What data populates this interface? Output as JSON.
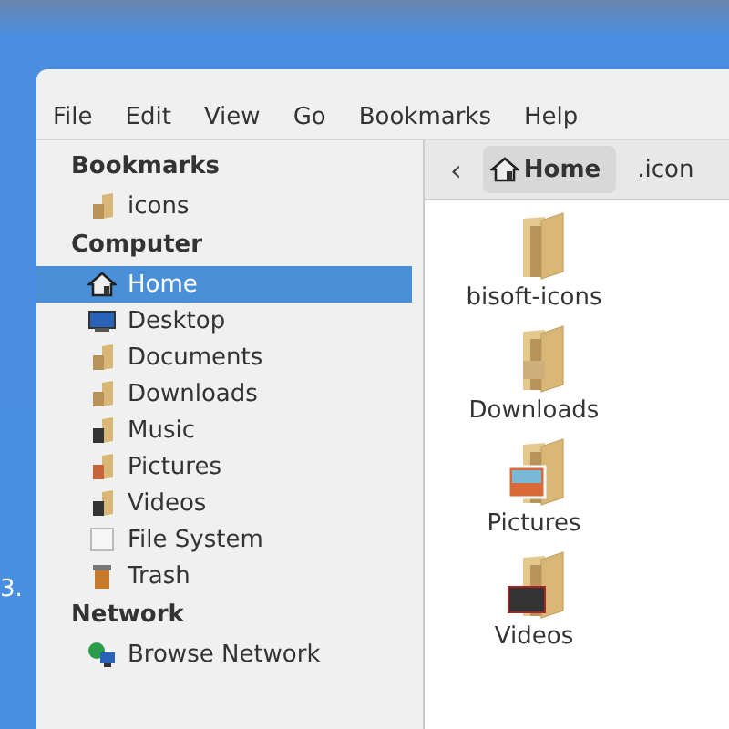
{
  "desktop_label": "3.",
  "menu": [
    "File",
    "Edit",
    "View",
    "Go",
    "Bookmarks",
    "Help"
  ],
  "sidebar": {
    "sections": [
      {
        "title": "Bookmarks",
        "items": [
          {
            "label": "icons",
            "kind": "folder",
            "selected": false
          }
        ]
      },
      {
        "title": "Computer",
        "items": [
          {
            "label": "Home",
            "kind": "home",
            "selected": true
          },
          {
            "label": "Desktop",
            "kind": "desktop",
            "selected": false
          },
          {
            "label": "Documents",
            "kind": "documents",
            "selected": false
          },
          {
            "label": "Downloads",
            "kind": "downloads",
            "selected": false
          },
          {
            "label": "Music",
            "kind": "music",
            "selected": false
          },
          {
            "label": "Pictures",
            "kind": "pictures",
            "selected": false
          },
          {
            "label": "Videos",
            "kind": "videos",
            "selected": false
          },
          {
            "label": "File System",
            "kind": "drive",
            "selected": false
          },
          {
            "label": "Trash",
            "kind": "trash",
            "selected": false
          }
        ]
      },
      {
        "title": "Network",
        "items": [
          {
            "label": "Browse Network",
            "kind": "network",
            "selected": false
          }
        ]
      }
    ]
  },
  "path_bar": {
    "back": "‹",
    "crumbs": [
      {
        "label": "Home",
        "selected": true
      },
      {
        "label": ".icon",
        "selected": false
      }
    ]
  },
  "files": [
    {
      "name": "bisoft-icons",
      "kind": "folder"
    },
    {
      "name": "Downloads",
      "kind": "downloads"
    },
    {
      "name": "Pictures",
      "kind": "pictures"
    },
    {
      "name": "Videos",
      "kind": "videos"
    }
  ]
}
